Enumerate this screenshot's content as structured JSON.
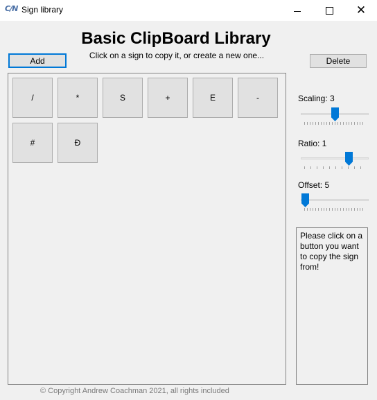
{
  "window": {
    "icon_text": "C/N",
    "title": "Sign library"
  },
  "header": {
    "title": "Basic ClipBoard Library",
    "subtitle": "Click on a sign to copy it, or create a new one..."
  },
  "buttons": {
    "add": "Add",
    "delete": "Delete"
  },
  "signs": [
    "/",
    "*",
    "S",
    "+",
    "E",
    "-",
    "#",
    "Đ"
  ],
  "sliders": {
    "scaling": {
      "label": "Scaling: 3",
      "value": 3
    },
    "ratio": {
      "label": "Ratio: 1",
      "value": 1
    },
    "offset": {
      "label": "Offset: 5",
      "value": 5
    }
  },
  "info": "Please click on a button you want to copy the sign from!",
  "footer": {
    "copyright": "© Copyright Andrew Coachman 2021, all rights included"
  },
  "colors": {
    "accent": "#0078d7",
    "button_face": "#e1e1e1",
    "window_bg": "#f0f0f0"
  }
}
